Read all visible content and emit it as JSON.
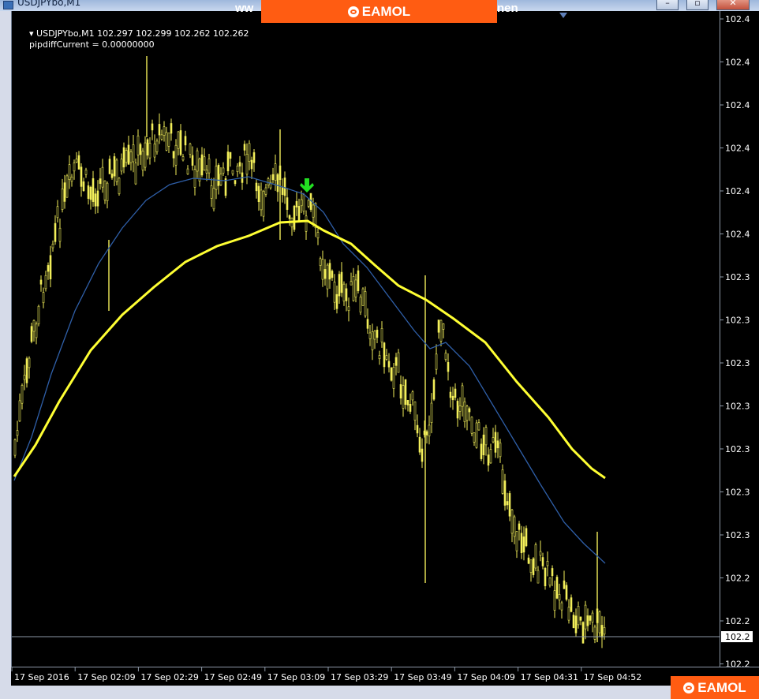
{
  "window": {
    "title": "USDJPYbo,M1",
    "minimize_glyph": "–",
    "maximize_glyph": "▫",
    "close_glyph": "✕"
  },
  "watermark": {
    "brand": "EAMOL",
    "overlay_text_left": "ww",
    "overlay_text_right": "nen"
  },
  "chart_info": {
    "symbol_line": "USDJPYbo,M1  102.297 102.299 102.262 102.262",
    "indicator_line": "pipdiffCurrent = 0.00000000"
  },
  "colors": {
    "background": "#000000",
    "candles": "#f2ee5a",
    "slow_ma": "#ffff33",
    "fast_ma": "#2f5fa8",
    "signal_arrow": "#22e022",
    "price_line": "#8d97a6"
  },
  "price_axis": {
    "labels": [
      "102.4",
      "102.4",
      "102.4",
      "102.4",
      "102.4",
      "102.4",
      "102.3",
      "102.3",
      "102.3",
      "102.3",
      "102.3",
      "102.3",
      "102.3",
      "102.2",
      "102.2",
      "102.2"
    ],
    "current_price": "102.2"
  },
  "time_axis": {
    "labels": [
      "17 Sep 2016",
      "17 Sep 02:09",
      "17 Sep 02:29",
      "17 Sep 02:49",
      "17 Sep 03:09",
      "17 Sep 03:29",
      "17 Sep 03:49",
      "17 Sep 04:09",
      "17 Sep 04:31",
      "17 Sep 04:52"
    ]
  },
  "chart_data": {
    "type": "candlestick",
    "symbol": "USDJPYbo",
    "timeframe": "M1",
    "last_bar": {
      "open": 102.297,
      "high": 102.299,
      "low": 102.262,
      "close": 102.262
    },
    "indicators": [
      {
        "name": "pipdiffCurrent",
        "value": 0.0
      }
    ],
    "x_ticks": [
      "17 Sep 2016",
      "17 Sep 02:09",
      "17 Sep 02:29",
      "17 Sep 02:49",
      "17 Sep 03:09",
      "17 Sep 03:29",
      "17 Sep 03:49",
      "17 Sep 04:09",
      "17 Sep 04:31",
      "17 Sep 04:52"
    ],
    "signals": [
      {
        "type": "sell-arrow",
        "near_tick": "17 Sep 03:09"
      }
    ],
    "grid": false
  }
}
